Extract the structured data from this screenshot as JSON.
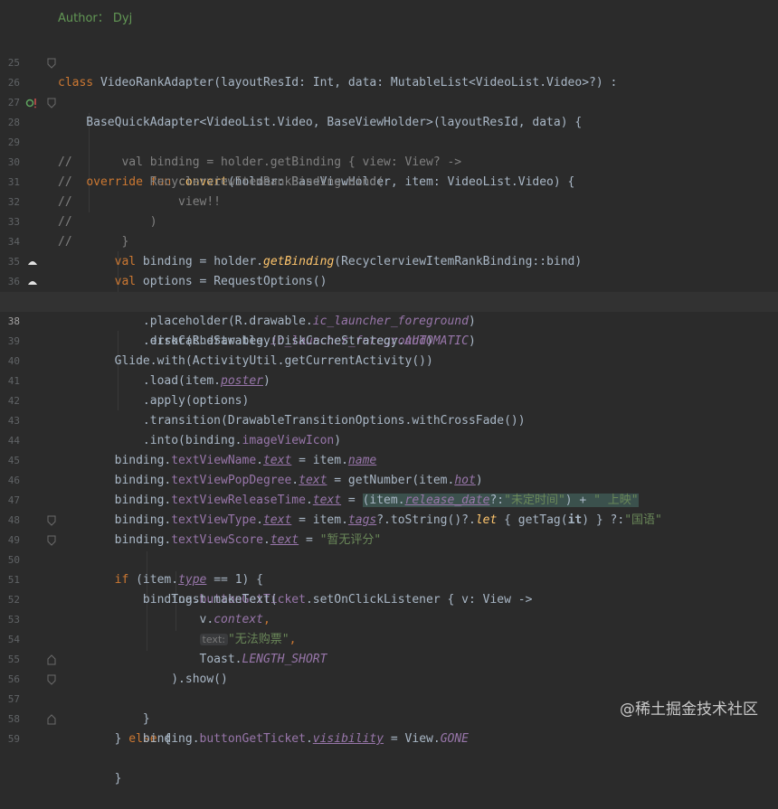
{
  "author_line": "Author： Dyj",
  "watermark": "@稀土掘金技术社区",
  "current_line": "38",
  "line_numbers": [
    "25",
    "26",
    "27",
    "28",
    "29",
    "30",
    "31",
    "32",
    "33",
    "34",
    "35",
    "36",
    "37",
    "38",
    "39",
    "40",
    "41",
    "42",
    "43",
    "44",
    "45",
    "46",
    "47",
    "48",
    "49",
    "50",
    "51",
    "52",
    "53",
    "54",
    "55",
    "56",
    "57",
    "58",
    "59"
  ],
  "code": {
    "l25": {
      "kw": "class",
      "name": " VideoRankAdapter",
      "rest": "(layoutResId: Int, data: MutableList<VideoList.Video>?) :"
    },
    "l26": {
      "text": "    BaseQuickAdapter<VideoList.Video, BaseViewHolder>(layoutResId, data) {"
    },
    "l28": {
      "indent": "    ",
      "kw": "override fun",
      "sp": " ",
      "fn": "convert",
      "rest": "(holder: BaseViewHolder, item: VideoList.Video) {"
    },
    "l29": "//       val binding = holder.getBinding { view: View? ->",
    "l30": "//           RecyclerviewItemRankBinding.bind(",
    "l31": "//               view!!",
    "l32": "//           )",
    "l33": "//       }",
    "l34": {
      "indent": "        ",
      "kw": "val",
      "a": " binding = holder.",
      "ext": "getBinding",
      "b": "(RecyclerviewItemRankBinding::bind)"
    },
    "l35": {
      "indent": "        ",
      "kw": "val",
      "a": " options = RequestOptions()"
    },
    "l36": {
      "a": "            .placeholder(R.drawable.",
      "p": "ic_launcher_foreground",
      "b": ")"
    },
    "l37": {
      "a": "            .error(R.drawable.",
      "p": "ic_launcher_foreground",
      "b": ")"
    },
    "l38": {
      "a": "            .diskCacheStrategy(DiskCacheStrategy.",
      "p": "AUTOMATIC",
      "b": ")"
    },
    "l39": "        Glide.with(ActivityUtil.getCurrentActivity())",
    "l40": {
      "a": "            .load(item.",
      "p": "poster",
      "b": ")"
    },
    "l41": "            .apply(options)",
    "l42": "            .transition(DrawableTransitionOptions.withCrossFade())",
    "l43": {
      "a": "            .into(binding.",
      "p": "imageViewIcon",
      "b": ")"
    },
    "l44": {
      "a": "        binding.",
      "p1": "textViewName",
      "dot": ".",
      "p2": "text",
      "b": " = item.",
      "p3": "name"
    },
    "l45": {
      "a": "        binding.",
      "p1": "textViewPopDegree",
      "dot": ".",
      "p2": "text",
      "b": " = getNumber(item.",
      "p3": "hot",
      "c": ")"
    },
    "l46": {
      "a": "        binding.",
      "p1": "textViewReleaseTime",
      "dot": ".",
      "p2": "text",
      "b": " = ",
      "h1": "(item.",
      "p3": "release_date",
      "h2": "?:",
      "s1": "\"未定时间\"",
      "h3": ") + ",
      "s2": "\" 上映\""
    },
    "l47": {
      "a": "        binding.",
      "p1": "textViewType",
      "dot": ".",
      "p2": "text",
      "b": " = item.",
      "p3": "tags",
      "c": "?.toString()?.",
      "kw": "let",
      "d": " { getTag(",
      "it": "it",
      "e": ") } ?:",
      "s": "\"国语\""
    },
    "l48": {
      "a": "        binding.",
      "p1": "textViewScore",
      "dot": ".",
      "p2": "text",
      "b": " = ",
      "s": "\"暂无评分\""
    },
    "l49": {
      "indent": "        ",
      "kw": "if",
      "a": " (item.",
      "p": "type",
      "b": " == 1) {"
    },
    "l50": {
      "a": "            binding.",
      "p": "buttonGetTicket",
      "b": ".setOnClickListener { v: View ->"
    },
    "l51": "                Toast.makeText(",
    "l52": {
      "a": "                    v.",
      "p": "context",
      "b": ","
    },
    "l53": {
      "a": "                    ",
      "hint": "text:",
      "s": "\"无法购票\"",
      "b": ","
    },
    "l54": {
      "a": "                    Toast.",
      "p": "LENGTH_SHORT"
    },
    "l55": "                ).show()",
    "l56": "            }",
    "l57": {
      "a": "        } ",
      "kw": "else",
      "b": " {"
    },
    "l58": {
      "a": "            binding.",
      "p1": "buttonGetTicket",
      "dot": ".",
      "p2": "visibility",
      "b": " = View.",
      "p3": "GONE"
    },
    "l59": "        }"
  }
}
